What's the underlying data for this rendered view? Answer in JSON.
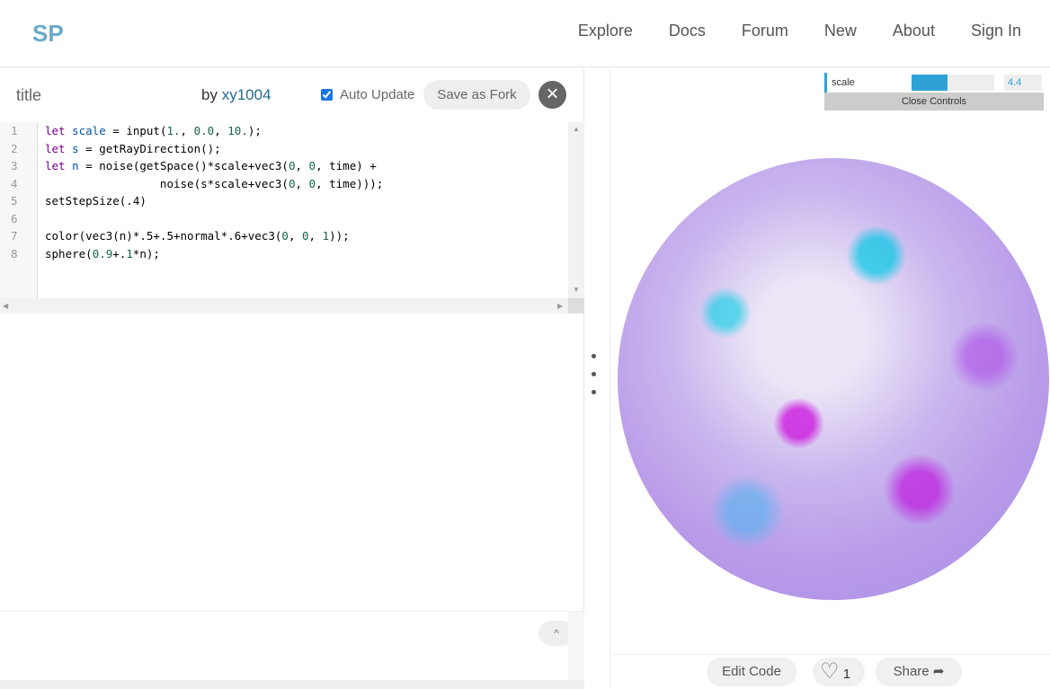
{
  "nav": {
    "logo": "SP",
    "links": [
      "Explore",
      "Docs",
      "Forum",
      "New",
      "About",
      "Sign In"
    ]
  },
  "editor_header": {
    "title": "title",
    "by": "by",
    "author": "xy1004",
    "auto_update_label": "Auto Update",
    "auto_update_checked": true,
    "fork_label": "Save as Fork",
    "close_icon": "close-x-icon"
  },
  "code": {
    "line_numbers": [
      "1",
      "2",
      "3",
      "4",
      "5",
      "6",
      "7",
      "8"
    ],
    "lines": [
      [
        [
          "let ",
          "kw"
        ],
        [
          "scale",
          "vr"
        ],
        [
          " = input(",
          ""
        ],
        [
          "1.",
          "nm"
        ],
        [
          ", ",
          ""
        ],
        [
          "0.0",
          "nm"
        ],
        [
          ", ",
          ""
        ],
        [
          "10.",
          "nm"
        ],
        [
          ");",
          ""
        ]
      ],
      [
        [
          "let ",
          "kw"
        ],
        [
          "s",
          "vr"
        ],
        [
          " = getRayDirection();",
          ""
        ]
      ],
      [
        [
          "let ",
          "kw"
        ],
        [
          "n",
          "vr"
        ],
        [
          " = noise(getSpace()*scale+vec3(",
          ""
        ],
        [
          "0",
          "nm"
        ],
        [
          ", ",
          ""
        ],
        [
          "0",
          "nm"
        ],
        [
          ", time) +",
          ""
        ]
      ],
      [
        [
          "                 noise(s*scale+vec3(",
          ""
        ],
        [
          "0",
          "nm"
        ],
        [
          ", ",
          ""
        ],
        [
          "0",
          "nm"
        ],
        [
          ", time)));",
          ""
        ]
      ],
      [
        [
          "setStepSize(.4)",
          ""
        ]
      ],
      [
        [
          "",
          ""
        ]
      ],
      [
        [
          "color(vec3(n)*.5+.5+normal*.6+vec3(",
          ""
        ],
        [
          "0",
          "nm"
        ],
        [
          ", ",
          ""
        ],
        [
          "0",
          "nm"
        ],
        [
          ", ",
          ""
        ],
        [
          "1",
          "nm"
        ],
        [
          "));",
          ""
        ]
      ],
      [
        [
          "sphere(",
          ""
        ],
        [
          "0.9",
          "nm"
        ],
        [
          "+.",
          ""
        ],
        [
          "1",
          "nm"
        ],
        [
          "*n);",
          ""
        ]
      ]
    ]
  },
  "controls": {
    "param_label": "scale",
    "param_value": "4.4",
    "param_min": 0,
    "param_max": 10,
    "close_label": "Close Controls",
    "accent": "#2fa1d6"
  },
  "viewer": {
    "edit_code_label": "Edit Code",
    "like_count": "1",
    "share_label": "Share"
  }
}
